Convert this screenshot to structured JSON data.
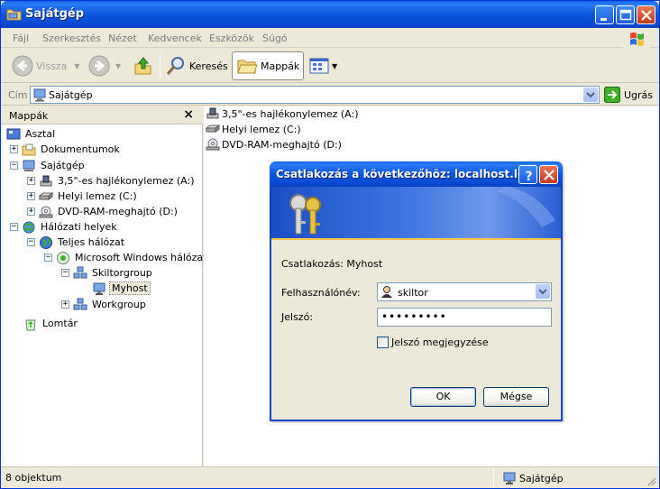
{
  "window": {
    "title": "Sajátgép"
  },
  "menu": [
    "Fájl",
    "Szerkesztés",
    "Nézet",
    "Kedvencek",
    "Eszközök",
    "Súgó"
  ],
  "toolbar": {
    "back": "Vissza",
    "search": "Keresés",
    "folders": "Mappák"
  },
  "address": {
    "label": "Cím",
    "value": "Sajátgép",
    "go": "Ugrás"
  },
  "left_pane": {
    "title": "Mappák",
    "tree": [
      {
        "label": "Asztal"
      },
      {
        "label": "Dokumentumok"
      },
      {
        "label": "Sajátgép"
      },
      {
        "label": "3,5\"-es hajlékonylemez (A:)"
      },
      {
        "label": "Helyi lemez (C:)"
      },
      {
        "label": "DVD-RAM-meghajtó (D:)"
      },
      {
        "label": "Hálózati helyek"
      },
      {
        "label": "Teljes hálózat"
      },
      {
        "label": "Microsoft Windows hálózat"
      },
      {
        "label": "Skiltorgroup"
      },
      {
        "label": "Myhost"
      },
      {
        "label": "Workgroup"
      },
      {
        "label": "Lomtár"
      }
    ]
  },
  "files": [
    {
      "label": "3,5\"-es hajlékonylemez (A:)"
    },
    {
      "label": "Helyi lemez (C:)"
    },
    {
      "label": "DVD-RAM-meghajtó (D:)"
    }
  ],
  "status": {
    "count": "8 objektum",
    "location": "Sajátgép"
  },
  "dialog": {
    "title": "Csatlakozás a következőhöz: localhost.lo...",
    "connecting": "Csatlakozás: Myhost",
    "username_label": "Felhasználónév:",
    "username_value": "skiltor",
    "password_label": "Jelszó:",
    "password_value": "•••••••••",
    "remember_label": "Jelszó megjegyzése",
    "remember_checked": false,
    "ok": "OK",
    "cancel": "Mégse"
  }
}
